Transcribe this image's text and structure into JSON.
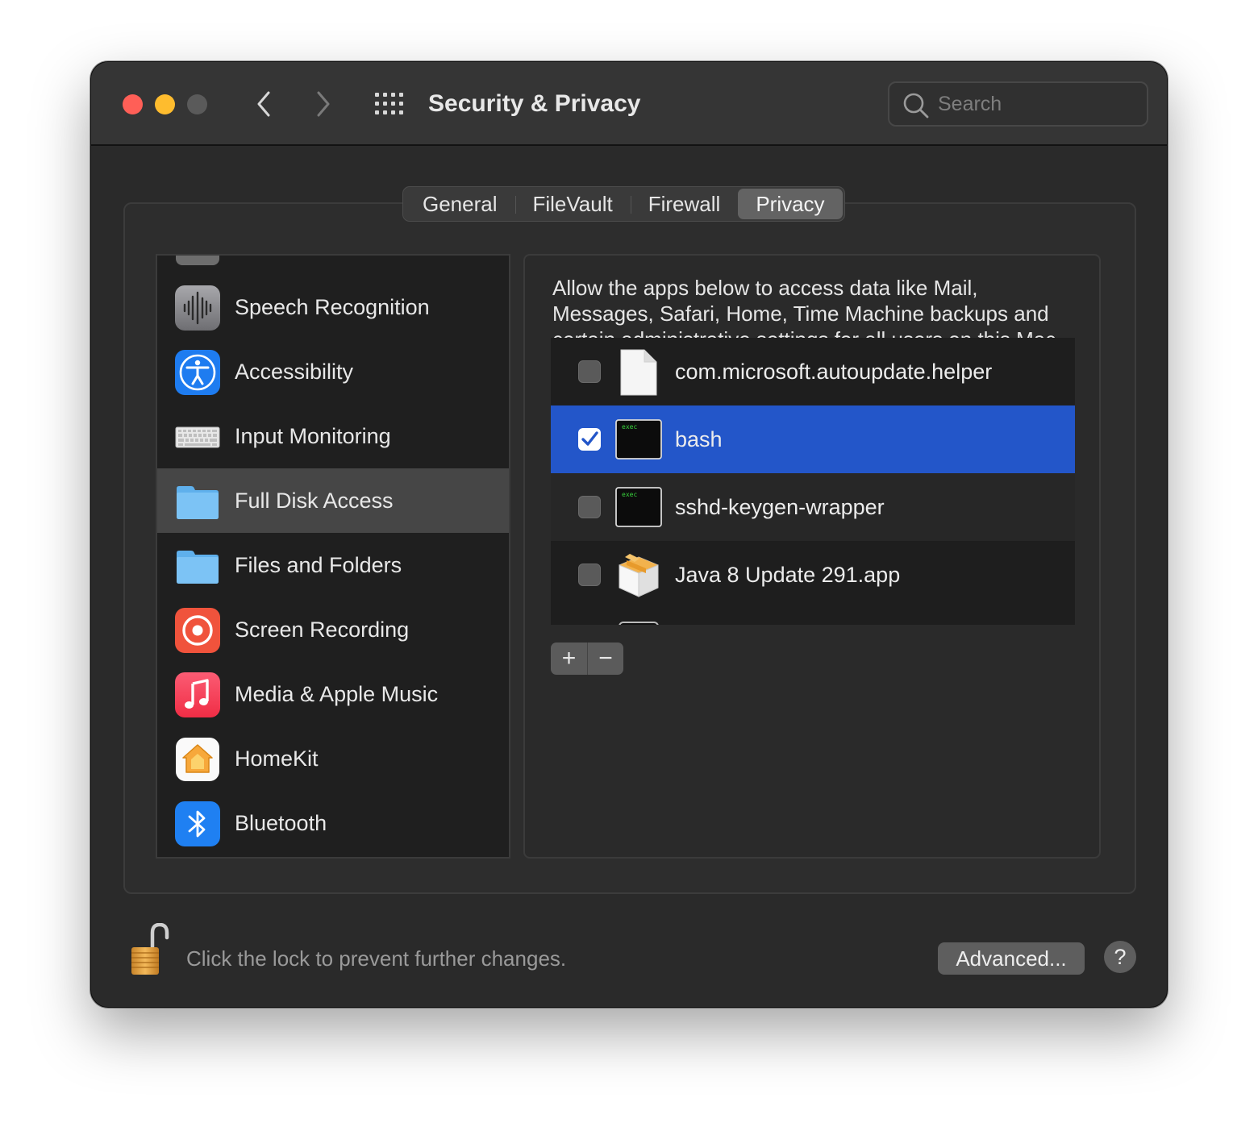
{
  "window": {
    "title": "Security & Privacy"
  },
  "search": {
    "placeholder": "Search",
    "value": ""
  },
  "tabs": [
    {
      "label": "General",
      "active": false
    },
    {
      "label": "FileVault",
      "active": false
    },
    {
      "label": "Firewall",
      "active": false
    },
    {
      "label": "Privacy",
      "active": true
    }
  ],
  "sidebar": {
    "items": [
      {
        "label": "Speech Recognition",
        "icon": "speech-waveform-icon",
        "selected": false
      },
      {
        "label": "Accessibility",
        "icon": "accessibility-icon",
        "selected": false
      },
      {
        "label": "Input Monitoring",
        "icon": "keyboard-icon",
        "selected": false
      },
      {
        "label": "Full Disk Access",
        "icon": "folder-icon",
        "selected": true
      },
      {
        "label": "Files and Folders",
        "icon": "folder-icon",
        "selected": false
      },
      {
        "label": "Screen Recording",
        "icon": "screen-recording-icon",
        "selected": false
      },
      {
        "label": "Media & Apple Music",
        "icon": "music-note-icon",
        "selected": false
      },
      {
        "label": "HomeKit",
        "icon": "home-icon",
        "selected": false
      },
      {
        "label": "Bluetooth",
        "icon": "bluetooth-icon",
        "selected": false
      }
    ]
  },
  "pane": {
    "description": "Allow the apps below to access data like Mail, Messages, Safari, Home, Time Machine backups and certain administrative settings for all users on this Mac.",
    "apps": [
      {
        "name": "com.microsoft.autoupdate.helper",
        "checked": false,
        "selected": false,
        "icon": "document-icon"
      },
      {
        "name": "bash",
        "checked": true,
        "selected": true,
        "icon": "terminal-exec-icon",
        "icon_text": "exec"
      },
      {
        "name": "sshd-keygen-wrapper",
        "checked": false,
        "selected": false,
        "icon": "terminal-exec-icon",
        "icon_text": "exec"
      },
      {
        "name": "Java 8 Update 291.app",
        "checked": false,
        "selected": false,
        "icon": "java-package-icon"
      }
    ],
    "add_label": "+",
    "remove_label": "−"
  },
  "footer": {
    "lock_text": "Click the lock to prevent further changes.",
    "advanced_label": "Advanced...",
    "help_label": "?"
  },
  "colors": {
    "selection_blue": "#2356c9",
    "window_bg": "#2a2a2a",
    "close": "#ff5f57",
    "minimize": "#febc2e"
  }
}
